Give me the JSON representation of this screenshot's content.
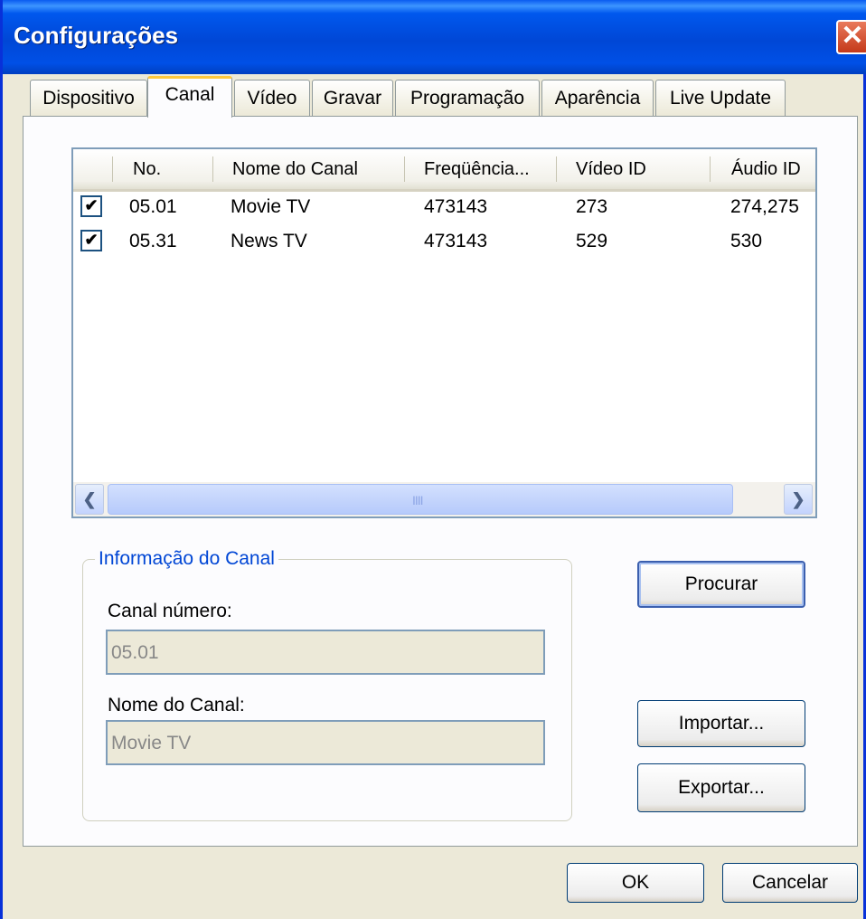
{
  "window": {
    "title": "Configurações",
    "close_symbol": "✕"
  },
  "tabs": [
    {
      "label": "Dispositivo",
      "active": false
    },
    {
      "label": "Canal",
      "active": true
    },
    {
      "label": "Vídeo",
      "active": false
    },
    {
      "label": "Gravar",
      "active": false
    },
    {
      "label": "Programação",
      "active": false
    },
    {
      "label": "Aparência",
      "active": false
    },
    {
      "label": "Live Update",
      "active": false
    }
  ],
  "channel_list": {
    "columns": [
      "No.",
      "Nome do Canal",
      "Freqüência...",
      "Vídeo ID",
      "Áudio ID"
    ],
    "rows": [
      {
        "checked": true,
        "check_symbol": "✔",
        "no": "05.01",
        "name": "Movie TV",
        "frequency": "473143",
        "video_id": "273",
        "audio_id": "274,275"
      },
      {
        "checked": true,
        "check_symbol": "✔",
        "no": "05.31",
        "name": "News TV",
        "frequency": "473143",
        "video_id": "529",
        "audio_id": "530"
      }
    ],
    "scroll_left_symbol": "❮",
    "scroll_right_symbol": "❯",
    "thumb_grip": "IIII"
  },
  "channel_info": {
    "group_title": "Informação do Canal",
    "number_label": "Canal número:",
    "number_value": "05.01",
    "name_label": "Nome do Canal:",
    "name_value": "Movie TV"
  },
  "buttons": {
    "search": "Procurar",
    "import": "Importar...",
    "export": "Exportar...",
    "ok": "OK",
    "cancel": "Cancelar"
  },
  "colors": {
    "title_bar": "#0054e3",
    "group_title": "#0046d5",
    "active_tab_accent": "#ffc83c",
    "close_button": "#d8502c"
  }
}
